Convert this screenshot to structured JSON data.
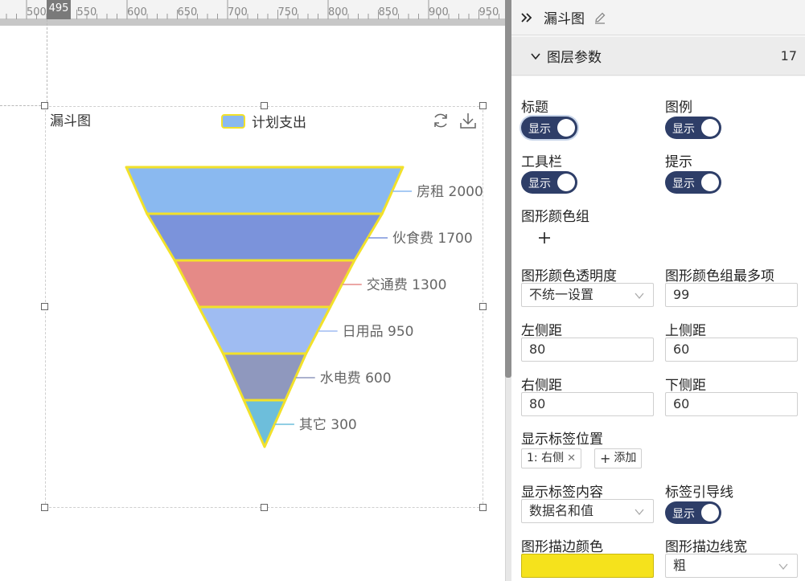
{
  "ruler": {
    "labels": [
      "500",
      "550",
      "600",
      "650",
      "700",
      "750",
      "800",
      "850",
      "900",
      "950"
    ],
    "marker": "495"
  },
  "chart": {
    "title": "漏斗图",
    "legend_label": "计划支出",
    "colors": {
      "stroke": "#f2e12a",
      "legend": "#8ab9f0"
    },
    "toolbox_icons": [
      "refresh-icon",
      "download-icon"
    ]
  },
  "chart_data": {
    "type": "funnel",
    "title": "漏斗图",
    "legend": [
      "计划支出"
    ],
    "label_position": "right",
    "stroke_color": "#f2e12a",
    "items": [
      {
        "name": "房租",
        "value": 2000,
        "label": "房租 2000",
        "color": "#8ab9f0"
      },
      {
        "name": "伙食费",
        "value": 1700,
        "label": "伙食费 1700",
        "color": "#7b93db"
      },
      {
        "name": "交通费",
        "value": 1300,
        "label": "交通费 1300",
        "color": "#e58a87"
      },
      {
        "name": "日用品",
        "value": 950,
        "label": "日用品 950",
        "color": "#9fbcf2"
      },
      {
        "name": "水电费",
        "value": 600,
        "label": "水电费 600",
        "color": "#8f98be"
      },
      {
        "name": "其它",
        "value": 300,
        "label": "其它 300",
        "color": "#6dbedb"
      }
    ]
  },
  "panel": {
    "title": "漏斗图",
    "section_title": "图层参数",
    "section_count": "17",
    "fields": {
      "title_label": "标题",
      "title_toggle": "显示",
      "legend_label": "图例",
      "legend_toggle": "显示",
      "toolbar_label": "工具栏",
      "toolbar_toggle": "显示",
      "tooltip_label": "提示",
      "tooltip_toggle": "显示",
      "color_group_label": "图形颜色组",
      "opacity_label": "图形颜色透明度",
      "opacity_value": "不统一设置",
      "max_colors_label": "图形颜色组最多项",
      "max_colors_value": "99",
      "left_margin_label": "左侧距",
      "left_margin_value": "80",
      "top_margin_label": "上侧距",
      "top_margin_value": "60",
      "right_margin_label": "右侧距",
      "right_margin_value": "80",
      "bottom_margin_label": "下侧距",
      "bottom_margin_value": "60",
      "label_pos_label": "显示标签位置",
      "label_pos_tag": "1: 右侧",
      "label_pos_add": "添加",
      "label_content_label": "显示标签内容",
      "label_content_value": "数据名和值",
      "guide_line_label": "标签引导线",
      "guide_line_toggle": "显示",
      "stroke_color_label": "图形描边颜色",
      "stroke_color_value": "#f5e21c",
      "stroke_width_label": "图形描边线宽",
      "stroke_width_value": "粗"
    }
  }
}
